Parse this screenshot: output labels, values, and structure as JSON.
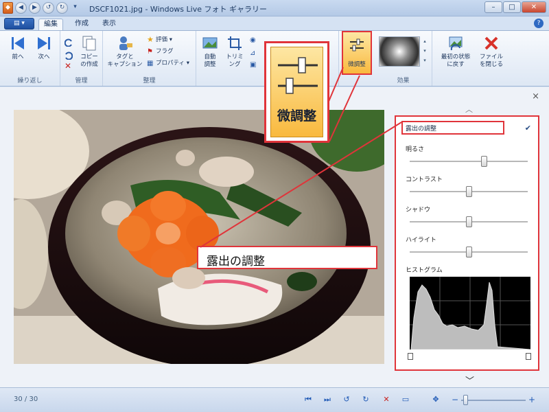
{
  "window": {
    "title": "DSCF1021.jpg - Windows Live フォト ギャラリー",
    "qat_buttons": [
      "◀",
      "▶",
      "↺",
      "↻",
      "▾"
    ],
    "controls": {
      "minimize": "–",
      "maximize": "□",
      "close": "✕"
    },
    "help": "?"
  },
  "tabs": {
    "app_button": "▤ ▾",
    "items": [
      {
        "label": "編集",
        "active": true
      },
      {
        "label": "作成",
        "active": false
      },
      {
        "label": "表示",
        "active": false
      }
    ]
  },
  "ribbon": {
    "groups": {
      "navigate": "繰り返し",
      "manage": "管理",
      "organize": "整理",
      "adjust": "",
      "effects": "効果",
      "close": ""
    },
    "buttons": {
      "prev": "前へ",
      "next": "次へ",
      "copy": "コピー\nの作成",
      "tag_caption": "タグと\nキャプション",
      "rating": "評価",
      "flag": "フラグ",
      "properties": "プロパティ",
      "auto_adjust": "自動\n調整",
      "crop": "トリミ\nング",
      "fine_tune": "微調整",
      "revert": "最初の状態\nに戻す",
      "close_file": "ファイル\nを閉じる"
    }
  },
  "viewer": {
    "close": "×",
    "collapse_up": "︿",
    "expand_down": "﹀"
  },
  "fine_tune_panel": {
    "header": "露出の調整",
    "check": "✔",
    "sliders": [
      {
        "label": "明るさ",
        "value": 0.63
      },
      {
        "label": "コントラスト",
        "value": 0.5
      },
      {
        "label": "シャドウ",
        "value": 0.5
      },
      {
        "label": "ハイライト",
        "value": 0.5
      }
    ],
    "histogram_label": "ヒストグラム"
  },
  "callouts": {
    "fine_tune": "微調整",
    "exposure": "露出の調整"
  },
  "statusbar": {
    "page_count": "30 / 30",
    "zoom_minus": "−",
    "zoom_plus": "+",
    "zoom_level": 0.06
  },
  "colors": {
    "accent_red": "#e0343a",
    "highlight_orange": "#f9b93e"
  }
}
